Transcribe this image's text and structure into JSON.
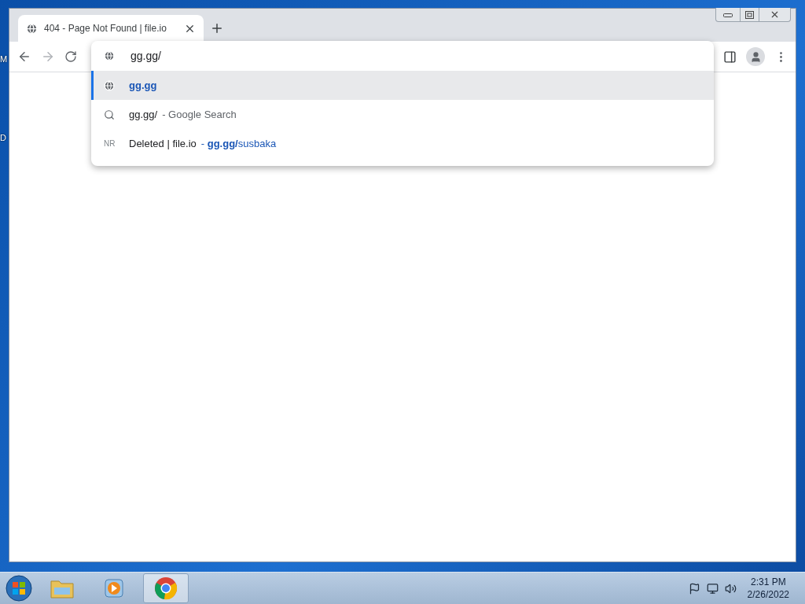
{
  "desktop": {
    "icon_labels": [
      "M",
      "D"
    ]
  },
  "browser": {
    "tabs": [
      {
        "title": "404 - Page Not Found | file.io",
        "selected": true
      }
    ],
    "omnibox": {
      "value": "gg.gg/"
    },
    "suggestions": [
      {
        "kind": "url",
        "text": "gg.gg",
        "selected": true
      },
      {
        "kind": "search",
        "text": "gg.gg/",
        "description": "- Google Search",
        "selected": false
      },
      {
        "kind": "history",
        "badge": "NR",
        "text": "Deleted | file.io",
        "description": "- **gg.gg/**susbaka",
        "selected": false
      }
    ]
  },
  "taskbar": {
    "apps": [
      {
        "kind": "folder",
        "selected": false
      },
      {
        "kind": "media",
        "selected": false
      },
      {
        "kind": "chrome",
        "selected": true
      }
    ],
    "clock": {
      "time": "2:31 PM",
      "date": "2/26/2022"
    }
  }
}
